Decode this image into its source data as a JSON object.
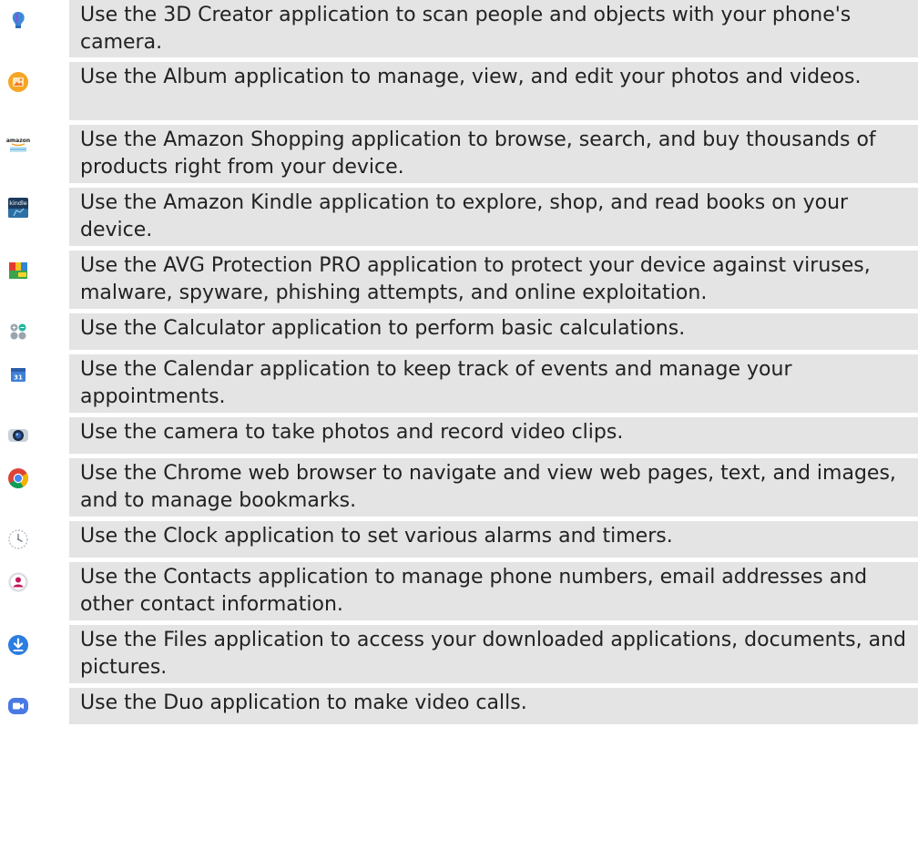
{
  "apps": [
    {
      "icon": "3d-creator-icon",
      "text": "Use the 3D Creator application to scan people and objects with your phone's camera."
    },
    {
      "icon": "album-icon",
      "text": "Use the Album application to manage, view, and edit your photos and videos."
    },
    {
      "icon": "amazon-shopping-icon",
      "text": "Use the Amazon Shopping application to browse, search, and buy thousands of products right from your device."
    },
    {
      "icon": "amazon-kindle-icon",
      "text": "Use the Amazon Kindle application to explore, shop, and read books on your device."
    },
    {
      "icon": "avg-protection-icon",
      "text": "Use the AVG Protection PRO application to protect your device against viruses, malware, spyware, phishing attempts, and online exploitation."
    },
    {
      "icon": "calculator-icon",
      "text": "Use the Calculator application to perform basic calculations."
    },
    {
      "icon": "calendar-icon",
      "text": "Use the Calendar application to keep track of events and manage your appointments."
    },
    {
      "icon": "camera-icon",
      "text": "Use the camera to take photos and record video clips."
    },
    {
      "icon": "chrome-icon",
      "text": "Use the Chrome web browser to navigate and view web pages, text, and images, and to manage bookmarks."
    },
    {
      "icon": "clock-icon",
      "text": "Use the Clock application to set various alarms and timers."
    },
    {
      "icon": "contacts-icon",
      "text": "Use the Contacts application to manage phone numbers, email addresses and other contact information."
    },
    {
      "icon": "files-icon",
      "text": "Use the Files application to access your downloaded applications, documents, and pictures."
    },
    {
      "icon": "duo-icon",
      "text": "Use the Duo application to make video calls."
    }
  ],
  "icon_labels": {
    "amazon": "amazon",
    "kindle": "kindle",
    "calendar_day": "31"
  }
}
